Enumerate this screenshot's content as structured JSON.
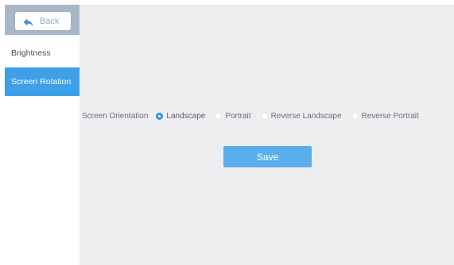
{
  "sidebar": {
    "back_label": "Back",
    "items": [
      {
        "label": "Brightness",
        "active": false
      },
      {
        "label": "Screen Rotation",
        "active": true
      }
    ]
  },
  "main": {
    "orientation_label": "Screen Orientation",
    "options": [
      {
        "label": "Landscape",
        "selected": true
      },
      {
        "label": "Portrait",
        "selected": false
      },
      {
        "label": "Reverse Landscape",
        "selected": false
      },
      {
        "label": "Reverse Portrait",
        "selected": false
      }
    ],
    "save_label": "Save"
  },
  "colors": {
    "accent": "#3ea0e8",
    "header_bg": "#a8b6c8",
    "panel_bg": "#eeeef0",
    "save_bg": "#5aaeea"
  },
  "icons": {
    "back": "back-arrow-icon"
  }
}
